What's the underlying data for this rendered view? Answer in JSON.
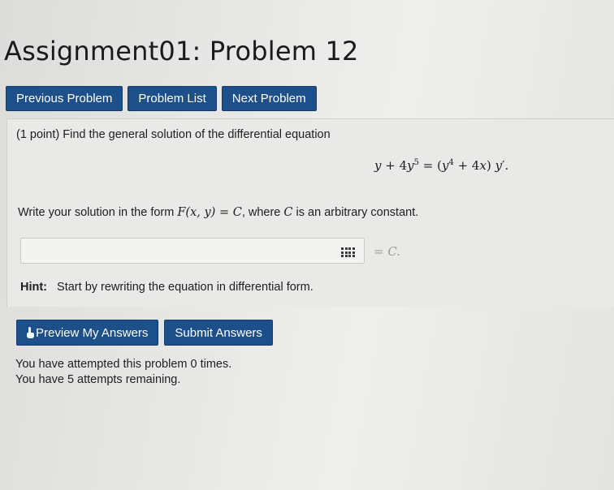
{
  "page": {
    "title": "Assignment01: Problem 12"
  },
  "nav": {
    "previous_label": "Previous Problem",
    "list_label": "Problem List",
    "next_label": "Next Problem"
  },
  "problem": {
    "points": "(1 point)",
    "intro": "Find the general solution of the differential equation",
    "instruction_prefix": "Write your solution in the form",
    "instruction_form": "F(x, y) = C",
    "instruction_middle": ", where",
    "instruction_var": "C",
    "instruction_suffix": "is an arbitrary constant.",
    "answer_value": "",
    "answer_suffix": "= C.",
    "hint_label": "Hint:",
    "hint_text": "Start by rewriting the equation in differential form."
  },
  "actions": {
    "preview_label": "Preview My Answers",
    "submit_label": "Submit Answers"
  },
  "status": {
    "attempted": "You have attempted this problem 0 times.",
    "remaining": "You have 5 attempts remaining."
  },
  "colors": {
    "button": "#1d4f8a",
    "background": "#e6e6e4"
  }
}
